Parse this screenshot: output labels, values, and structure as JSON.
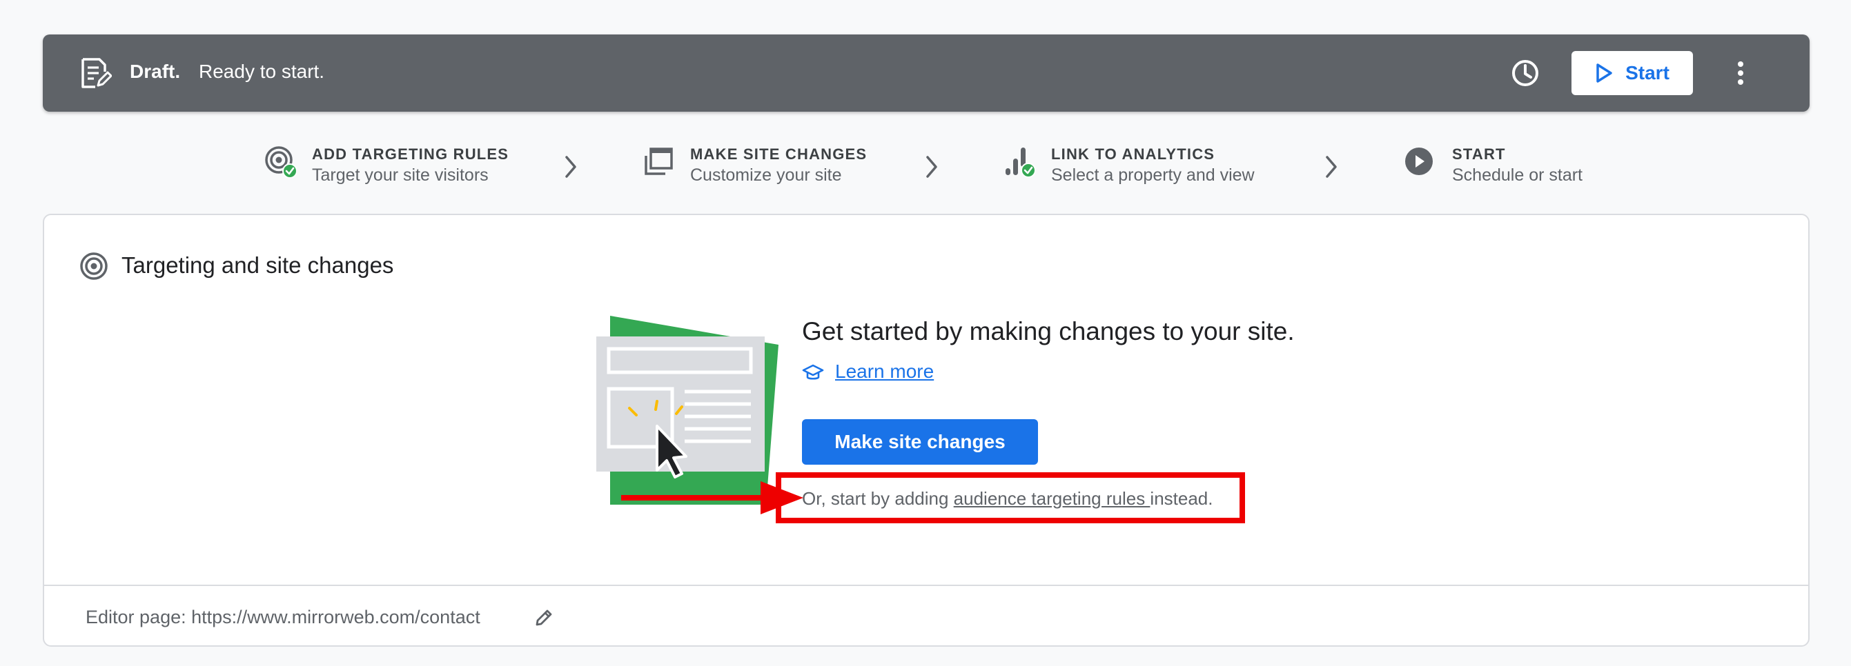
{
  "status_bar": {
    "state": "Draft.",
    "message": "Ready to start.",
    "start_label": "Start",
    "icons": [
      "draft-document-icon",
      "history-icon",
      "play-icon",
      "more-vert-icon"
    ]
  },
  "steps": [
    {
      "title": "ADD TARGETING RULES",
      "subtitle": "Target your site visitors",
      "icon": "target-check-icon",
      "done": true
    },
    {
      "title": "MAKE SITE CHANGES",
      "subtitle": "Customize your site",
      "icon": "layers-icon",
      "done": false
    },
    {
      "title": "LINK TO ANALYTICS",
      "subtitle": "Select a property and view",
      "icon": "analytics-check-icon",
      "done": true
    },
    {
      "title": "START",
      "subtitle": "Schedule or start",
      "icon": "play-circle-icon",
      "done": false
    }
  ],
  "card": {
    "title": "Targeting and site changes",
    "headline": "Get started by making changes to your site.",
    "learn_more": "Learn more",
    "primary_button": "Make site changes",
    "alt_prefix": "Or, start by adding ",
    "alt_link": "audience targeting rules ",
    "alt_suffix": "instead.",
    "footer_label": "Editor page: https://www.mirrorweb.com/contact"
  },
  "colors": {
    "status_bar_bg": "#5f6368",
    "accent_blue": "#1a73e8",
    "check_green": "#34a853",
    "annotation_red": "#ee0000"
  }
}
